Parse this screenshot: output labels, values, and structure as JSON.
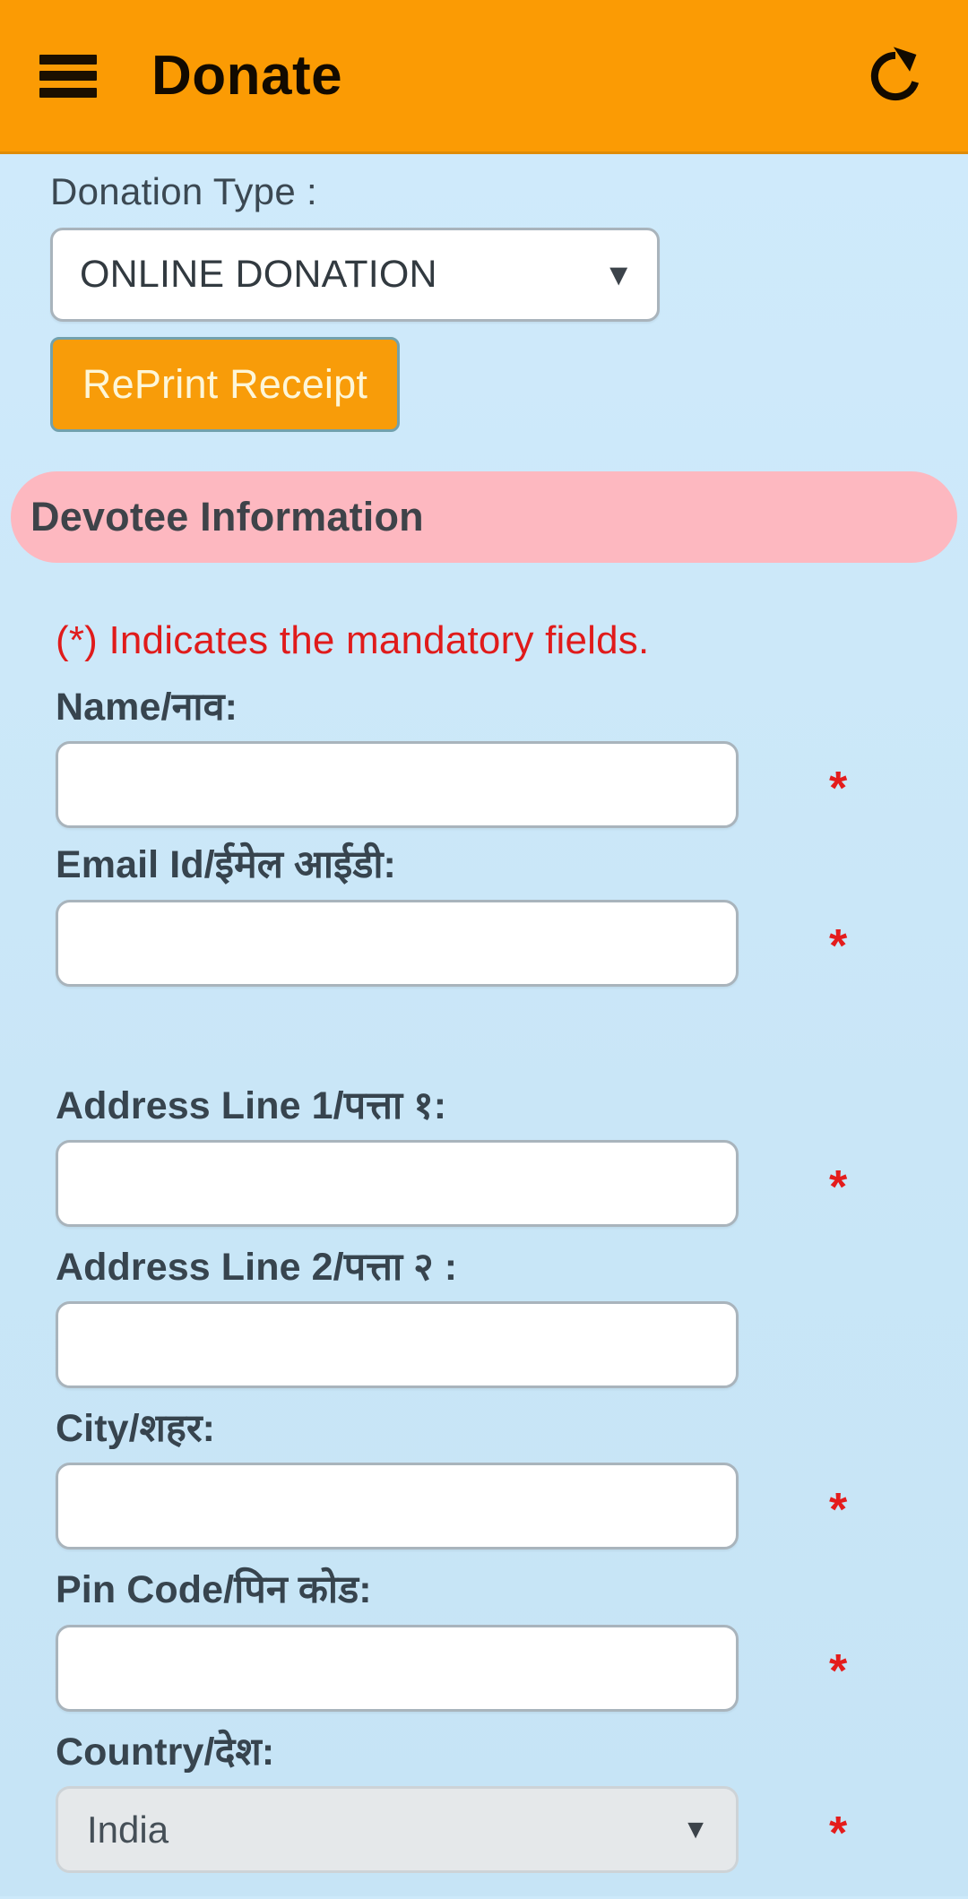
{
  "appbar": {
    "menu_icon": "hamburger-menu-icon",
    "title": "Donate",
    "refresh_icon": "refresh-icon",
    "background_color": "#fb9b04"
  },
  "donation_type": {
    "label": "Donation Type :",
    "selected": "ONLINE DONATION",
    "caret": "▼"
  },
  "reprint_button": {
    "label": "RePrint Receipt",
    "background_color": "#f89c09",
    "text_color": "#fdf6d8"
  },
  "section": {
    "title": "Devotee Information",
    "background_color": "#fdb8c0"
  },
  "mandatory_note": {
    "text": "(*) Indicates the mandatory fields.",
    "color": "#e01b1b"
  },
  "required_marker": "*",
  "fields": [
    {
      "key": "name",
      "label": "Name/नाव:",
      "value": "",
      "placeholder": "",
      "required": true,
      "type": "text"
    },
    {
      "key": "email",
      "label": "Email Id/ईमेल आईडी:",
      "value": "",
      "placeholder": "",
      "required": true,
      "type": "text"
    },
    {
      "key": "address1",
      "label": "Address Line 1/पत्ता १:",
      "value": "",
      "placeholder": "",
      "required": true,
      "type": "text"
    },
    {
      "key": "address2",
      "label": "Address Line 2/पत्ता २ :",
      "value": "",
      "placeholder": "",
      "required": false,
      "type": "text"
    },
    {
      "key": "city",
      "label": "City/शहर:",
      "value": "",
      "placeholder": "",
      "required": true,
      "type": "text"
    },
    {
      "key": "pincode",
      "label": "Pin Code/पिन कोड:",
      "value": "",
      "placeholder": "",
      "required": true,
      "type": "text"
    },
    {
      "key": "country",
      "label": "Country/देश:",
      "value": "India",
      "placeholder": "",
      "required": true,
      "type": "select",
      "caret": "▼"
    }
  ],
  "colors": {
    "page_background": "#cde9fa",
    "accent_orange": "#fb9b04",
    "banner_pink": "#fdb8c0",
    "required_red": "#e41c1c",
    "label_gray": "#37444e"
  }
}
